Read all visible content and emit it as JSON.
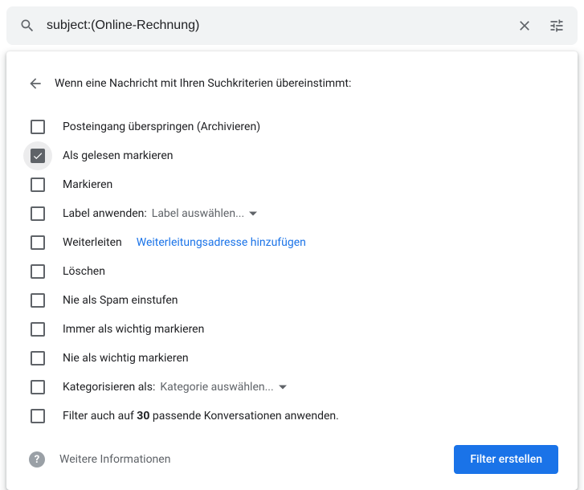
{
  "search": {
    "query": "subject:(Online-Rechnung)"
  },
  "panel": {
    "title": "Wenn eine Nachricht mit Ihren Suchkriterien übereinstimmt:"
  },
  "options": {
    "skip_inbox": {
      "label": "Posteingang überspringen (Archivieren)",
      "checked": false
    },
    "mark_read": {
      "label": "Als gelesen markieren",
      "checked": true
    },
    "star": {
      "label": "Markieren",
      "checked": false
    },
    "apply_label": {
      "label": "Label anwenden:",
      "checked": false,
      "dropdown": "Label auswählen..."
    },
    "forward": {
      "label": "Weiterleiten",
      "checked": false,
      "link": "Weiterleitungsadresse hinzufügen"
    },
    "delete": {
      "label": "Löschen",
      "checked": false
    },
    "never_spam": {
      "label": "Nie als Spam einstufen",
      "checked": false
    },
    "always_important": {
      "label": "Immer als wichtig markieren",
      "checked": false
    },
    "never_important": {
      "label": "Nie als wichtig markieren",
      "checked": false
    },
    "categorize": {
      "label": "Kategorisieren als:",
      "checked": false,
      "dropdown": "Kategorie auswählen..."
    },
    "apply_existing": {
      "prefix": "Filter auch auf ",
      "count": "30",
      "suffix": " passende Konversationen anwenden.",
      "checked": false
    }
  },
  "footer": {
    "more_info": "Weitere Informationen",
    "create_button": "Filter erstellen"
  }
}
